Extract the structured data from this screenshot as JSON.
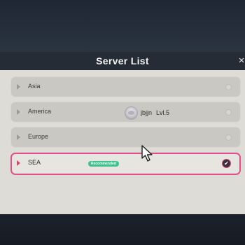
{
  "modal": {
    "title": "Server List",
    "close_glyph": "×"
  },
  "servers": [
    {
      "name": "Asia",
      "selected": false
    },
    {
      "name": "America",
      "selected": false,
      "player": {
        "name": "jbjjn",
        "level": "Lvl.5"
      }
    },
    {
      "name": "Europe",
      "selected": false
    },
    {
      "name": "SEA",
      "selected": true,
      "badge": "Recommended"
    }
  ],
  "icons": {
    "arrow": "arrow-right-icon",
    "radio": "radio-icon",
    "check": "check-icon",
    "cursor": "mouse-cursor-icon"
  },
  "colors": {
    "accent": "#e0508a",
    "badge": "#3ec28d",
    "header": "#262c36",
    "panel": "#dedcd6"
  }
}
